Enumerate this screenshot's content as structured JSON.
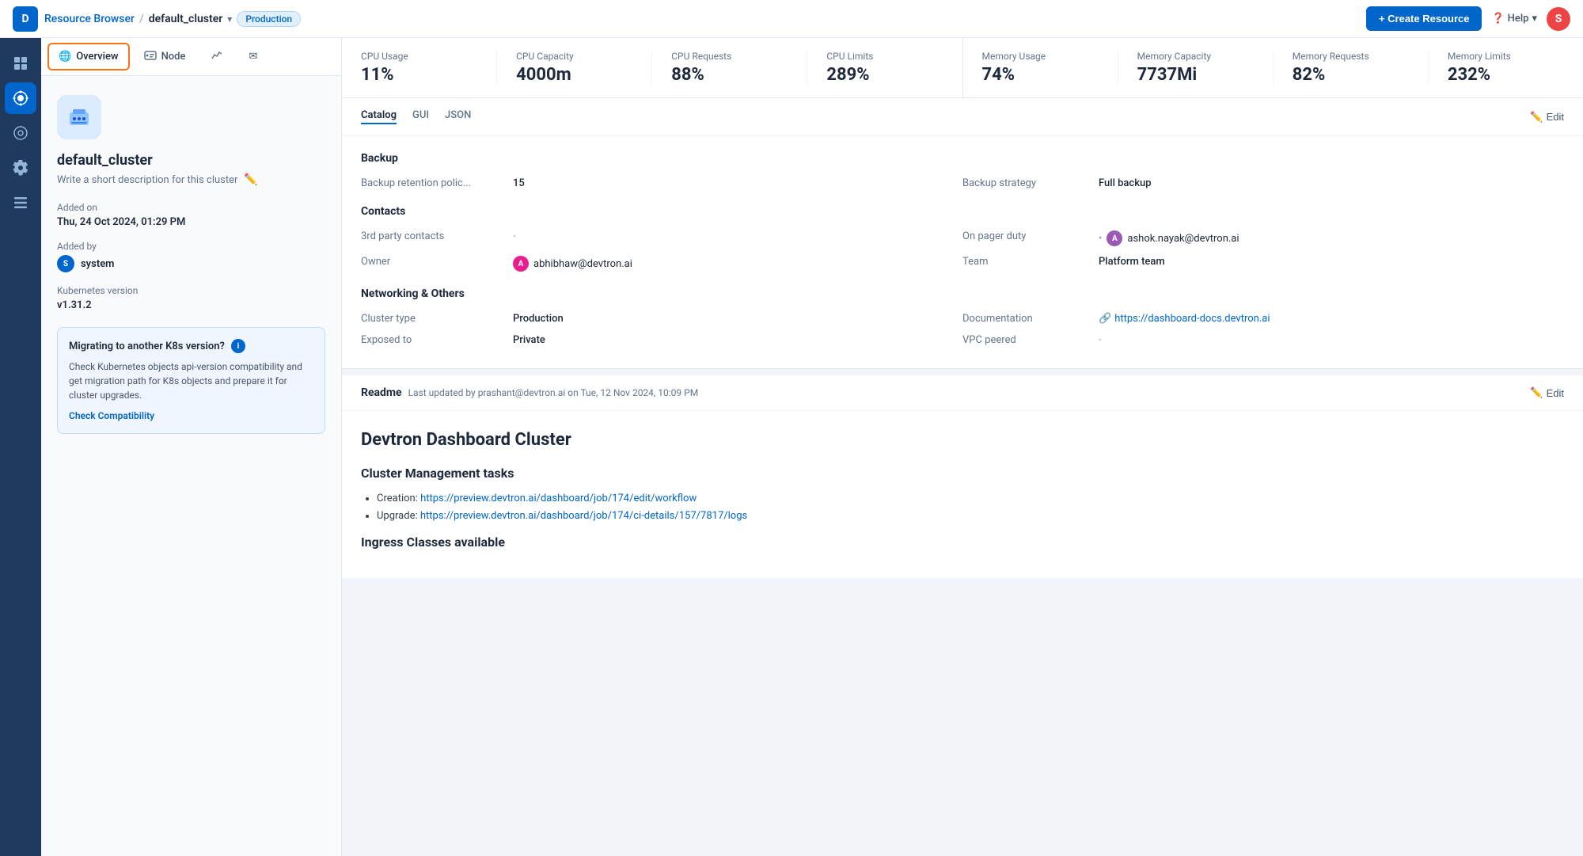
{
  "topNav": {
    "logo": "D",
    "breadcrumb": {
      "link": "Resource Browser",
      "separator": "/",
      "current": "default_cluster",
      "env": "Production"
    },
    "createResourceLabel": "+ Create Resource",
    "helpLabel": "Help",
    "userInitial": "S"
  },
  "sidebar": {
    "icons": [
      {
        "name": "grid-icon",
        "glyph": "⊞",
        "active": false
      },
      {
        "name": "resource-icon",
        "glyph": "◈",
        "active": true
      },
      {
        "name": "settings-circle-icon",
        "glyph": "◎",
        "active": false
      },
      {
        "name": "gear-icon",
        "glyph": "⚙",
        "active": false
      },
      {
        "name": "layers-icon",
        "glyph": "≡",
        "active": false
      }
    ]
  },
  "tabs": [
    {
      "id": "overview",
      "label": "Overview",
      "icon": "globe",
      "active": true
    },
    {
      "id": "node",
      "label": "Node",
      "icon": "node",
      "active": false
    },
    {
      "id": "chart",
      "label": "",
      "icon": "chart",
      "active": false
    },
    {
      "id": "envelope",
      "label": "",
      "icon": "envelope",
      "active": false
    }
  ],
  "clusterInfo": {
    "name": "default_cluster",
    "description": "Write a short description for this cluster",
    "addedOnLabel": "Added on",
    "addedOnValue": "Thu, 24 Oct 2024, 01:29 PM",
    "addedByLabel": "Added by",
    "addedByAvatar": "S",
    "addedByName": "system",
    "k8sLabel": "Kubernetes version",
    "k8sVersion": "v1.31.2",
    "migrationCard": {
      "title": "Migrating to another K8s version?",
      "body": "Check Kubernetes objects api-version compatibility and get migration path for K8s objects and prepare it for cluster upgrades.",
      "linkLabel": "Check Compatibility"
    }
  },
  "metrics": {
    "left": [
      {
        "label": "CPU Usage",
        "value": "11%"
      },
      {
        "label": "CPU Capacity",
        "value": "4000m"
      },
      {
        "label": "CPU Requests",
        "value": "88%"
      },
      {
        "label": "CPU Limits",
        "value": "289%"
      }
    ],
    "right": [
      {
        "label": "Memory Usage",
        "value": "74%"
      },
      {
        "label": "Memory Capacity",
        "value": "7737Mi"
      },
      {
        "label": "Memory Requests",
        "value": "82%"
      },
      {
        "label": "Memory Limits",
        "value": "232%"
      }
    ]
  },
  "catalog": {
    "tabs": [
      "Catalog",
      "GUI",
      "JSON"
    ],
    "activeTab": "Catalog",
    "editLabel": "Edit",
    "sections": {
      "backup": {
        "title": "Backup",
        "fields": [
          {
            "label": "Backup retention polic...",
            "value": "15",
            "col": "left"
          },
          {
            "label": "Backup strategy",
            "value": "Full backup",
            "col": "right"
          }
        ]
      },
      "contacts": {
        "title": "Contacts",
        "fields": [
          {
            "label": "3rd party contacts",
            "value": "-",
            "col": "left",
            "type": "text"
          },
          {
            "label": "On pager duty",
            "value": "ashok.nayak@devtron.ai",
            "col": "right",
            "type": "contact",
            "avatarType": "a2"
          },
          {
            "label": "Owner",
            "value": "abhibhaw@devtron.ai",
            "col": "left",
            "type": "contact",
            "avatarType": "a"
          },
          {
            "label": "Team",
            "value": "Platform team",
            "col": "right",
            "type": "text"
          }
        ]
      },
      "networking": {
        "title": "Networking & Others",
        "fields": [
          {
            "label": "Cluster type",
            "value": "Production",
            "col": "left",
            "type": "text"
          },
          {
            "label": "Documentation",
            "value": "https://dashboard-docs.devtron.ai",
            "col": "right",
            "type": "link"
          },
          {
            "label": "Exposed to",
            "value": "Private",
            "col": "left",
            "type": "text"
          },
          {
            "label": "VPC peered",
            "value": "-",
            "col": "right",
            "type": "text"
          }
        ]
      }
    }
  },
  "readme": {
    "title": "Readme",
    "updatedText": "Last updated by prashant@devtron.ai on Tue, 12 Nov 2024, 10:09 PM",
    "editLabel": "Edit",
    "content": {
      "h1": "Devtron Dashboard Cluster",
      "sections": [
        {
          "h2": "Cluster Management tasks",
          "items": [
            {
              "prefix": "Creation: ",
              "link": "https://preview.devtron.ai/dashboard/job/174/edit/workflow",
              "linkText": "https://preview.devtron.ai/dashboard/job/174/edit/workflow"
            },
            {
              "prefix": "Upgrade: ",
              "link": "https://preview.devtron.ai/dashboard/job/174/ci-details/157/7817/logs",
              "linkText": "https://preview.devtron.ai/dashboard/job/174/ci-details/157/7817/logs"
            }
          ]
        },
        {
          "h2": "Ingress Classes available"
        }
      ]
    }
  }
}
